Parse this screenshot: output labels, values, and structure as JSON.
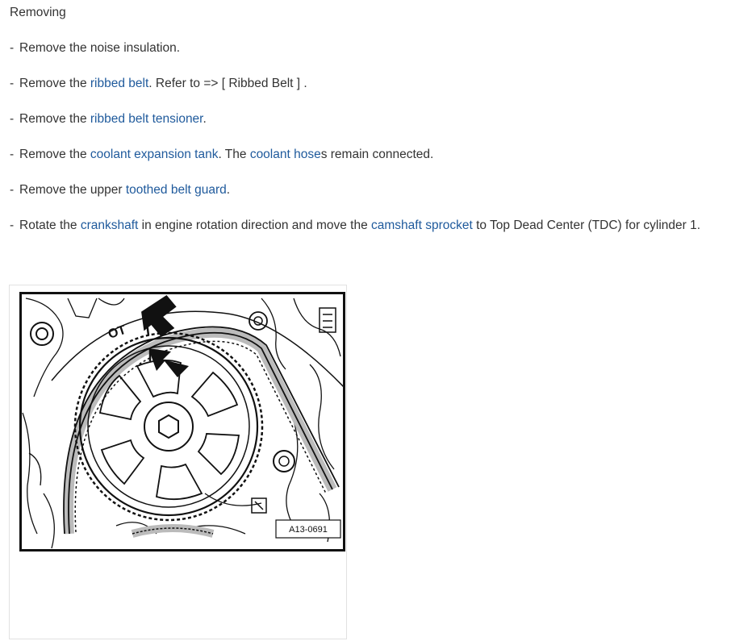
{
  "section": {
    "heading": "Removing"
  },
  "steps": [
    {
      "prefix": "-",
      "t0": "Remove the noise insulation."
    },
    {
      "prefix": "-",
      "t0": "Remove the ",
      "l0": "ribbed belt",
      "t1": ". Refer to => [ Ribbed Belt ] ."
    },
    {
      "prefix": "-",
      "t0": "Remove the ",
      "l0": "ribbed belt tensioner",
      "t1": "."
    },
    {
      "prefix": "-",
      "t0": "Remove the ",
      "l0": "coolant expansion tank",
      "t1": ". The ",
      "l1": "coolant hose",
      "t2": "s remain connected."
    },
    {
      "prefix": "-",
      "t0": "Remove the upper ",
      "l0": "toothed belt guard",
      "t1": "."
    },
    {
      "prefix": "-",
      "t0": "Rotate the ",
      "l0": "crankshaft",
      "t1": " in engine rotation direction and move the ",
      "l1": "camshaft sprocket",
      "t2": " to Top Dead Center (TDC) for cylinder 1."
    }
  ],
  "figure": {
    "code": "A13-0691",
    "mark_label": "OT",
    "link_color": "#1f5a9c"
  }
}
